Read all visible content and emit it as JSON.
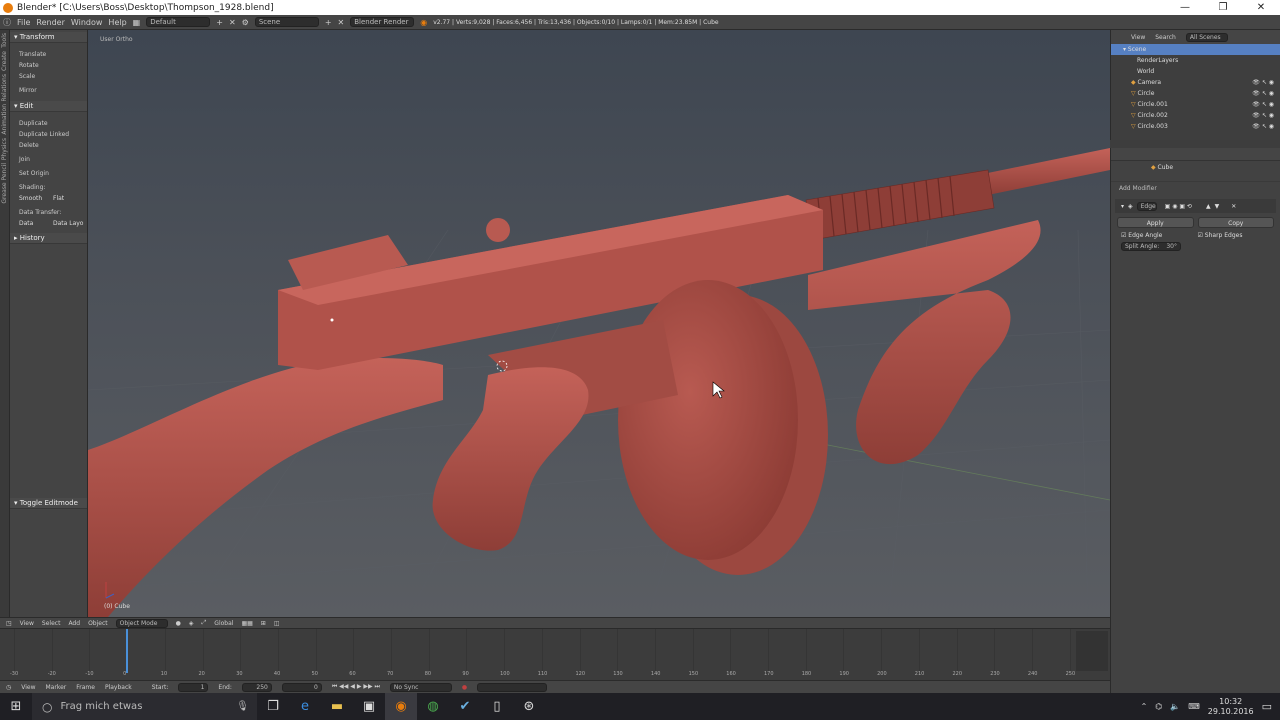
{
  "window": {
    "title": "Blender* [C:\\Users\\Boss\\Desktop\\Thompson_1928.blend]",
    "controls": [
      "—",
      "❐",
      "✕"
    ]
  },
  "info_header": {
    "menus": [
      "File",
      "Render",
      "Window",
      "Help"
    ],
    "layout": "Default",
    "scene": "Scene",
    "engine": "Blender Render",
    "stats": "v2.77 | Verts:9,028 | Faces:6,456 | Tris:13,436 | Objects:0/10 | Lamps:0/1 | Mem:23.85M | Cube"
  },
  "left_tabs": [
    "Tools",
    "Create",
    "Relations",
    "Animation",
    "Physics",
    "Grease Pencil"
  ],
  "toolshelf": {
    "transform_head": "Transform",
    "transform": [
      "Translate",
      "Rotate",
      "Scale",
      "Mirror"
    ],
    "edit_head": "Edit",
    "edit": [
      "Duplicate",
      "Duplicate Linked",
      "Delete",
      "Join"
    ],
    "set_origin": "Set Origin",
    "shading_label": "Shading:",
    "shading": [
      "Smooth",
      "Flat"
    ],
    "data_transfer_label": "Data Transfer:",
    "data_transfer": [
      "Data",
      "Data Layo"
    ],
    "history_head": "History",
    "toggle_editmode": "Toggle Editmode"
  },
  "viewport": {
    "view_label": "User Ortho",
    "object_label": "(0) Cube"
  },
  "viewport_header": {
    "menus": [
      "View",
      "Select",
      "Add",
      "Object"
    ],
    "mode": "Object Mode",
    "orientation": "Global"
  },
  "timeline": {
    "ticks": [
      -30,
      -20,
      -10,
      0,
      10,
      20,
      30,
      40,
      50,
      60,
      70,
      80,
      90,
      100,
      110,
      120,
      130,
      140,
      150,
      160,
      170,
      180,
      190,
      200,
      210,
      220,
      230,
      240,
      250
    ],
    "current_frame_display": "0"
  },
  "timeline_header": {
    "menus": [
      "View",
      "Marker",
      "Frame",
      "Playback"
    ],
    "start_label": "Start:",
    "start": "1",
    "end_label": "End:",
    "end": "250",
    "frame": "0",
    "sync": "No Sync"
  },
  "outliner": {
    "header": [
      "View",
      "Search",
      "All Scenes"
    ],
    "items": [
      {
        "label": "Scene",
        "selected": true
      },
      {
        "label": "RenderLayers"
      },
      {
        "label": "World"
      },
      {
        "label": "Camera"
      },
      {
        "label": "Circle"
      },
      {
        "label": "Circle.001"
      },
      {
        "label": "Circle.002"
      },
      {
        "label": "Circle.003"
      }
    ]
  },
  "properties": {
    "object_name": "Cube",
    "add_modifier": "Add Modifier",
    "modifier_name": "Edge",
    "apply": "Apply",
    "copy": "Copy",
    "edge_angle": "Edge Angle",
    "sharp_edges": "Sharp Edges",
    "split_angle": "Split Angle:",
    "split_angle_value": "30°"
  },
  "taskbar": {
    "search_placeholder": "Frag mich etwas",
    "time": "10:32",
    "date": "29.10.2016"
  },
  "colors": {
    "model": "#b4544b",
    "model_dark": "#8a3a33",
    "accent_orange": "#e87d0d",
    "selection_blue": "#5680c2"
  }
}
